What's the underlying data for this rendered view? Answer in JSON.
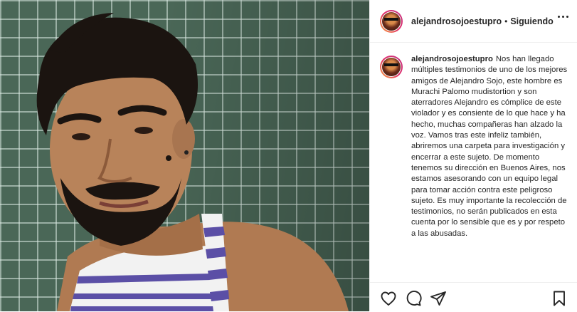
{
  "post": {
    "username": "alejandrosojoestupro",
    "separator": "•",
    "follow_status": "Siguiendo",
    "caption": "Nos han llegado múltiples testimonios de uno de los mejores amigos de Alejandro Sojo, este hombre es Murachi Palomo mudistortion y son aterradores Alejandro es cómplice de este violador y es consiente de lo que hace y ha hecho, muchas compañeras han alzado la voz. Vamos tras este infeliz también, abriremos una carpeta para investigación y encerrar a este sujeto. De momento tenemos su dirección en Buenos Aires, nos estamos asesorando con un equipo legal para tomar acción contra este peligroso sujeto. Es muy importante la recolección de testimonios, no serán publicados en esta cuenta por lo sensible que es y por respeto a las abusadas."
  },
  "icons": {
    "more": "more-options-icon",
    "like": "heart-icon",
    "comment": "comment-icon",
    "share": "share-icon",
    "save": "bookmark-icon"
  },
  "colors": {
    "text": "#262626",
    "border": "#efefef",
    "ring_start": "#f9a33b",
    "ring_end": "#c13584"
  }
}
